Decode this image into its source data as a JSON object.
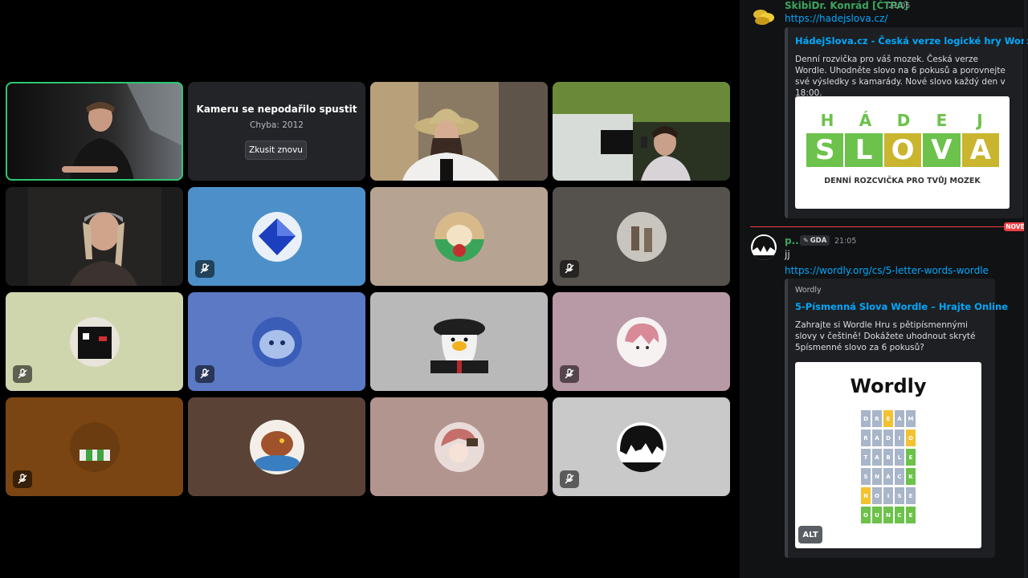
{
  "error_tile": {
    "title": "Kameru se nepodařilo spustit",
    "subtitle": "Chyba: 2012",
    "retry_label": "Zkusit znovu"
  },
  "chat": {
    "new_label": "NOVÉ",
    "messages": [
      {
        "author": "SkibiDr. Konrád [ČTPA]",
        "time": "21:05",
        "link": "https://hadejslova.cz/",
        "embed": {
          "title": "HádejSlova.cz - Česká verze logické hry Wordle.",
          "description": "Denní rozvička pro váš mozek. Česká verze Wordle. Uhodněte slovo na 6 pokusů a porovnejte své výsledky s kamarády. Nové slovo každý den v 18:00.",
          "image": {
            "top_letters": [
              "H",
              "Á",
              "D",
              "E",
              "J"
            ],
            "bottom_letters": [
              "S",
              "L",
              "O",
              "V",
              "A"
            ],
            "tagline": "DENNÍ ROZCVIČKA PRO TVŮJ MOZEK"
          }
        }
      },
      {
        "author": "p...",
        "tag": "GDA",
        "time": "21:05",
        "text": "jj",
        "link": "https://wordly.org/cs/5-letter-words-wordle",
        "embed": {
          "provider": "Wordly",
          "title": "5-Písmenná Slova Wordle – Hrajte Online",
          "description": "Zahrajte si Wordle Hru s pětipísmennými slovy v češtině! Dokážete uhodnout skryté 5písmenné slovo za 6 pokusů?",
          "image": {
            "heading": "Wordly",
            "alt_label": "ALT",
            "words": [
              "DREAM",
              "RADIO",
              "TABLE",
              "SNACK",
              "NOISE",
              "OUNCE"
            ]
          }
        }
      }
    ]
  },
  "colors": {
    "speaking_outline": "#2dc770",
    "link": "#00a8fc",
    "username": "#3ba55d",
    "new_divider": "#f23f43",
    "hadej_green": "#6cc24a",
    "hadej_yellow": "#c9b52e"
  }
}
